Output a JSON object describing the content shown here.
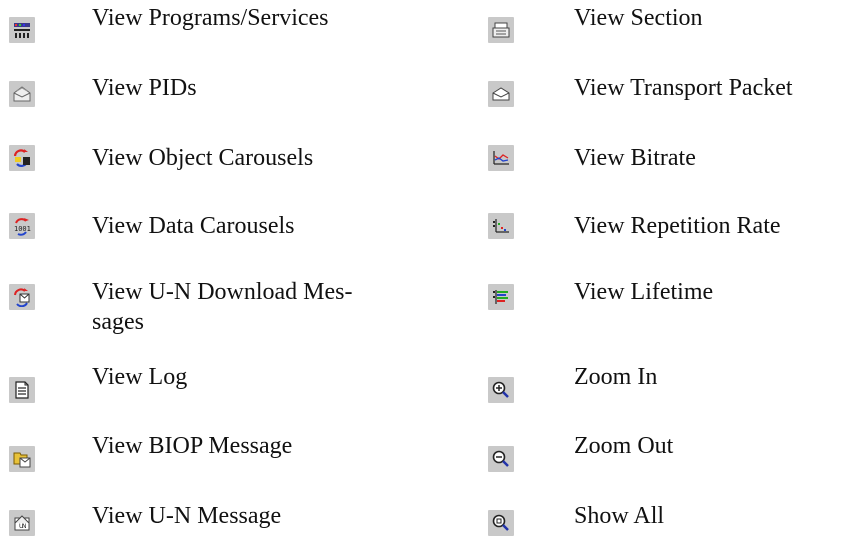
{
  "left_items": [
    {
      "label": "View Programs/Services",
      "icon": "programs-services-icon"
    },
    {
      "label": "View PIDs",
      "icon": "pids-icon"
    },
    {
      "label": "View Object Carousels",
      "icon": "object-carousels-icon"
    },
    {
      "label": "View Data Carousels",
      "icon": "data-carousels-icon"
    },
    {
      "label": "View U-N Download Mes-",
      "label2": "sages",
      "icon": "un-download-messages-icon"
    },
    {
      "label": "View Log",
      "icon": "log-icon"
    },
    {
      "label": "View BIOP Message",
      "icon": "biop-message-icon"
    },
    {
      "label": "View U-N Message",
      "icon": "un-message-icon"
    }
  ],
  "right_items": [
    {
      "label": "View Section",
      "icon": "section-icon"
    },
    {
      "label": "View Transport Packet",
      "icon": "transport-packet-icon"
    },
    {
      "label": "View Bitrate",
      "icon": "bitrate-icon"
    },
    {
      "label": "View Repetition Rate",
      "icon": "repetition-rate-icon"
    },
    {
      "label": "View Lifetime",
      "icon": "lifetime-icon"
    },
    {
      "label": "Zoom In",
      "icon": "zoom-in-icon"
    },
    {
      "label": "Zoom Out",
      "icon": "zoom-out-icon"
    },
    {
      "label": "Show All",
      "icon": "show-all-icon"
    }
  ],
  "colors": {
    "icon_background": "#c9c9c9",
    "text": "#111111"
  }
}
